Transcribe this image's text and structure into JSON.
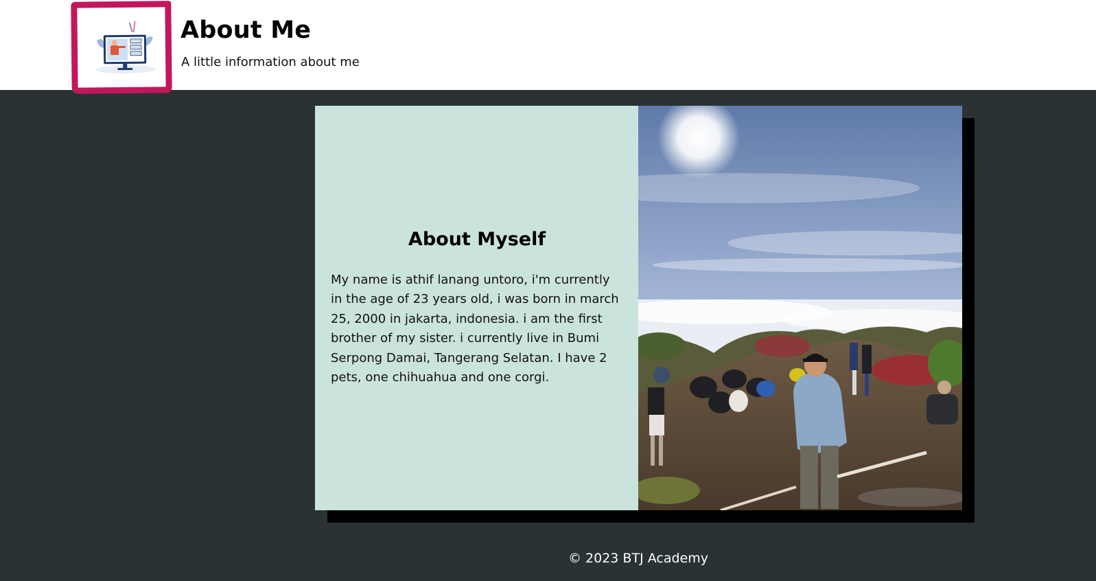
{
  "header": {
    "title": "About Me",
    "subtitle": "A little information about me",
    "logo_icon": "presentation-monitor-icon",
    "logo_frame_color": "#c2185b"
  },
  "card": {
    "heading": "About Myself",
    "bio": "My name is athif lanang untoro, i'm currently in the age of 23 years old, i was born in march 25, 2000 in jakarta, indonesia. i am the first brother of my sister. i currently live in Bumi Serpong Damai, Tangerang Selatan. I have 2 pets, one chihuahua and one corgi.",
    "panel_color": "#cbe3dd",
    "photo_icon": "mountain-summit-photo"
  },
  "footer": {
    "copyright": "© 2023 BTJ Academy"
  },
  "colors": {
    "background": "#2a3233",
    "header_bg": "#ffffff",
    "shadow": "#000000"
  }
}
